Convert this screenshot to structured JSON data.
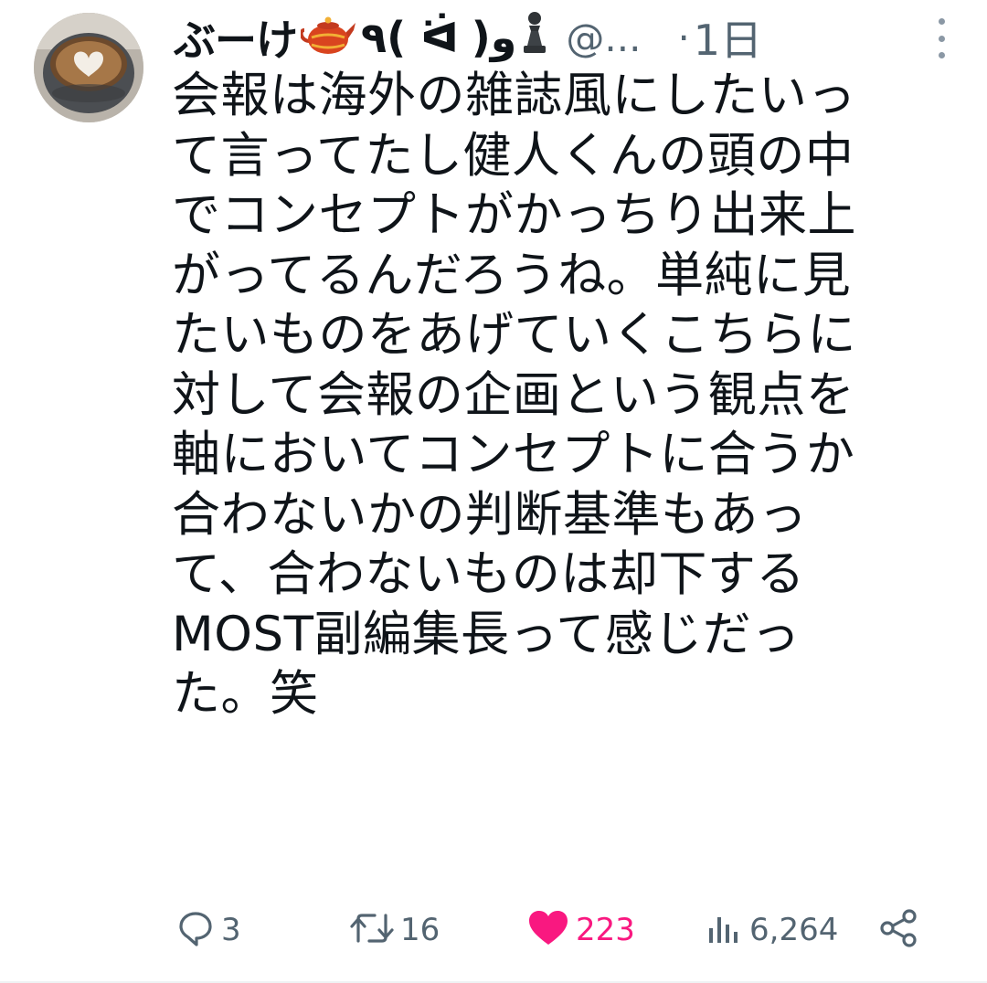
{
  "tweet": {
    "display_name": "ぶーけ",
    "name_decoration_text": "٩( ᐛ )و",
    "handle": "@...",
    "separator": "·",
    "time": "1日",
    "body_lines": [
      "会報は海外の雑誌風にしたいっ",
      "て言ってたし健人くんの頭の中",
      "でコンセプトがかっちり出来上",
      "がってるんだろうね。単純に見",
      "たいものをあげていくこちらに",
      "対して会報の企画という観点を",
      "軸においてコンセプトに合うか",
      "合わないかの判断基準もあっ",
      "て、合わないものは却下する",
      "MOST副編集長って感じだっ",
      "た。笑"
    ],
    "name_icons": [
      "teapot-icon",
      "chess-pawn-icon"
    ]
  },
  "actions": {
    "reply_count": "3",
    "retweet_count": "16",
    "like_count": "223",
    "views_count": "6,264"
  },
  "colors": {
    "text": "#0f1419",
    "secondary": "#536471",
    "like": "#f91880"
  }
}
